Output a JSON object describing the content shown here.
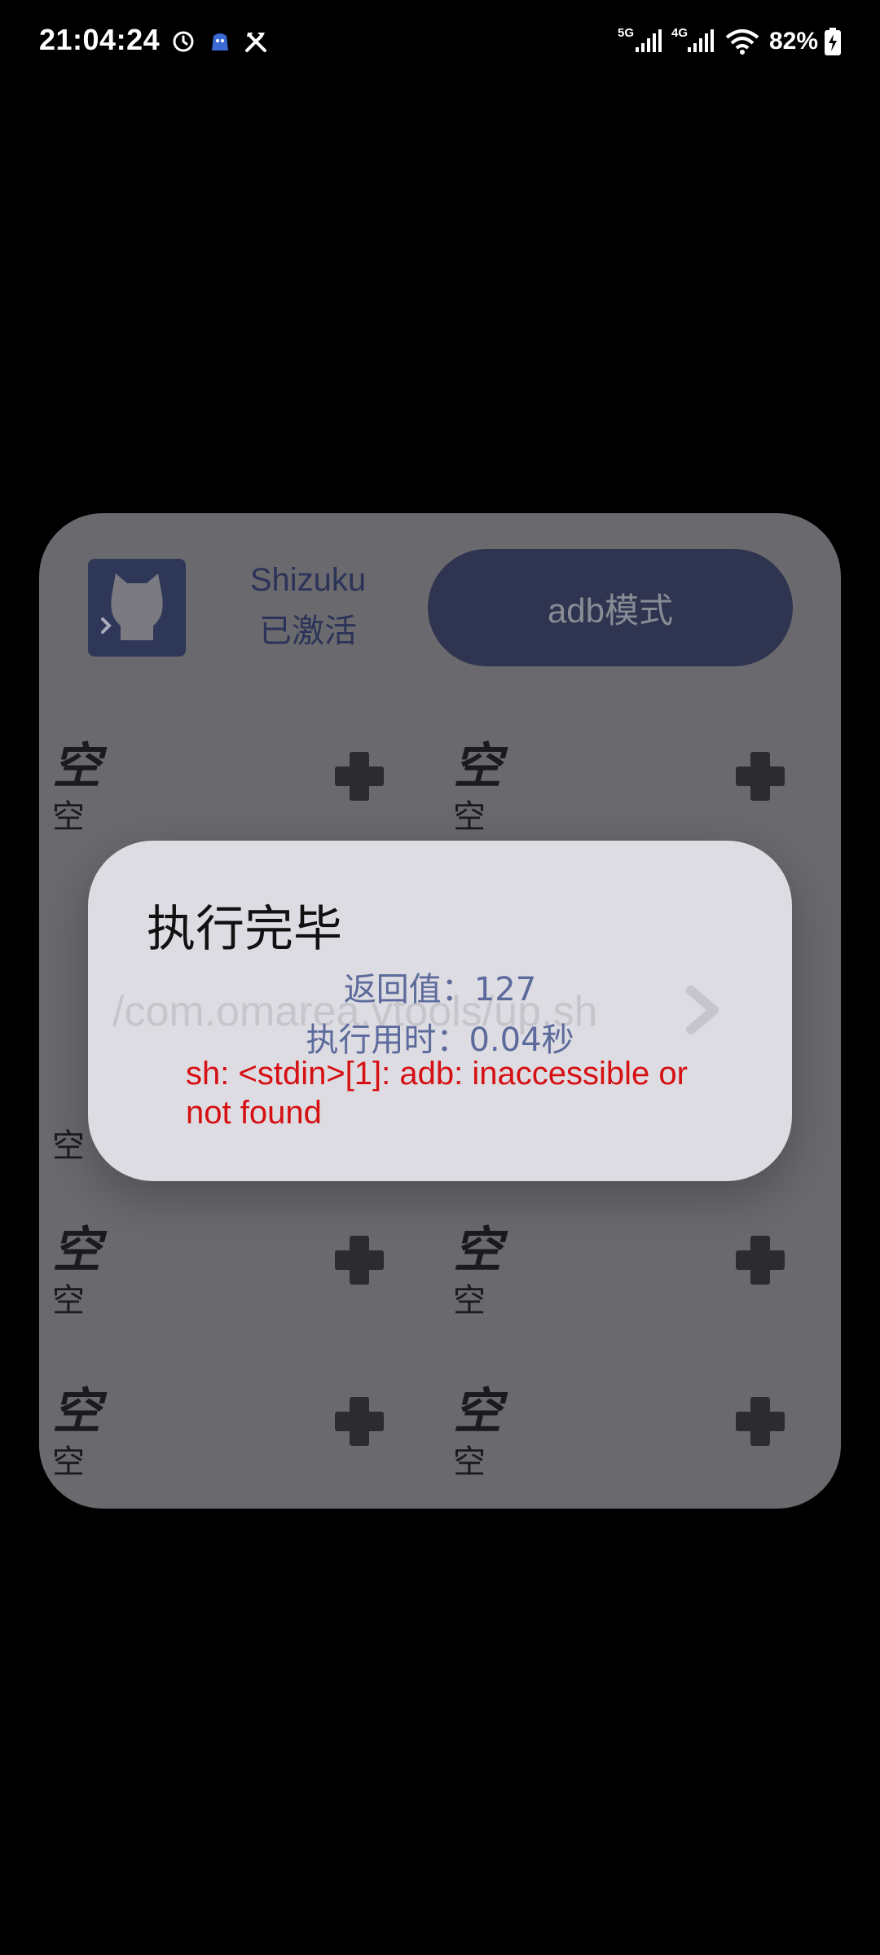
{
  "status_bar": {
    "time": "21:04:24",
    "signal_5g": "5G",
    "signal_4g": "4G",
    "battery": "82%",
    "icons": [
      "alarm-icon",
      "app-notification-icon",
      "tools-icon",
      "signal-5g-icon",
      "signal-4g-icon",
      "wifi-icon",
      "battery-charging-icon"
    ]
  },
  "widget": {
    "service_name": "Shizuku",
    "service_status": "已激活",
    "mode_button": "adb模式",
    "slots": [
      {
        "title": "空",
        "subtitle": "空"
      },
      {
        "title": "空",
        "subtitle": "空"
      },
      {
        "title": "空",
        "subtitle": "空"
      },
      {
        "title": "空",
        "subtitle": "空"
      },
      {
        "title": "空",
        "subtitle": "空"
      },
      {
        "title": "空",
        "subtitle": "空"
      }
    ],
    "partial_labels": [
      "空",
      "空"
    ]
  },
  "dialog": {
    "title": "执行完毕",
    "background_path": "/com.omarea.vtools/up.sh",
    "return_value": "返回值：127",
    "duration": "执行用时：0.04秒",
    "error_output": "sh: <stdin>[1]: adb: inaccessible or not found"
  },
  "colors": {
    "widget_bg": "#6a696d",
    "dialog_bg": "#dddce2",
    "accent": "#2f3550",
    "info_text": "#5c6a9c",
    "error_text": "#d60f12"
  }
}
